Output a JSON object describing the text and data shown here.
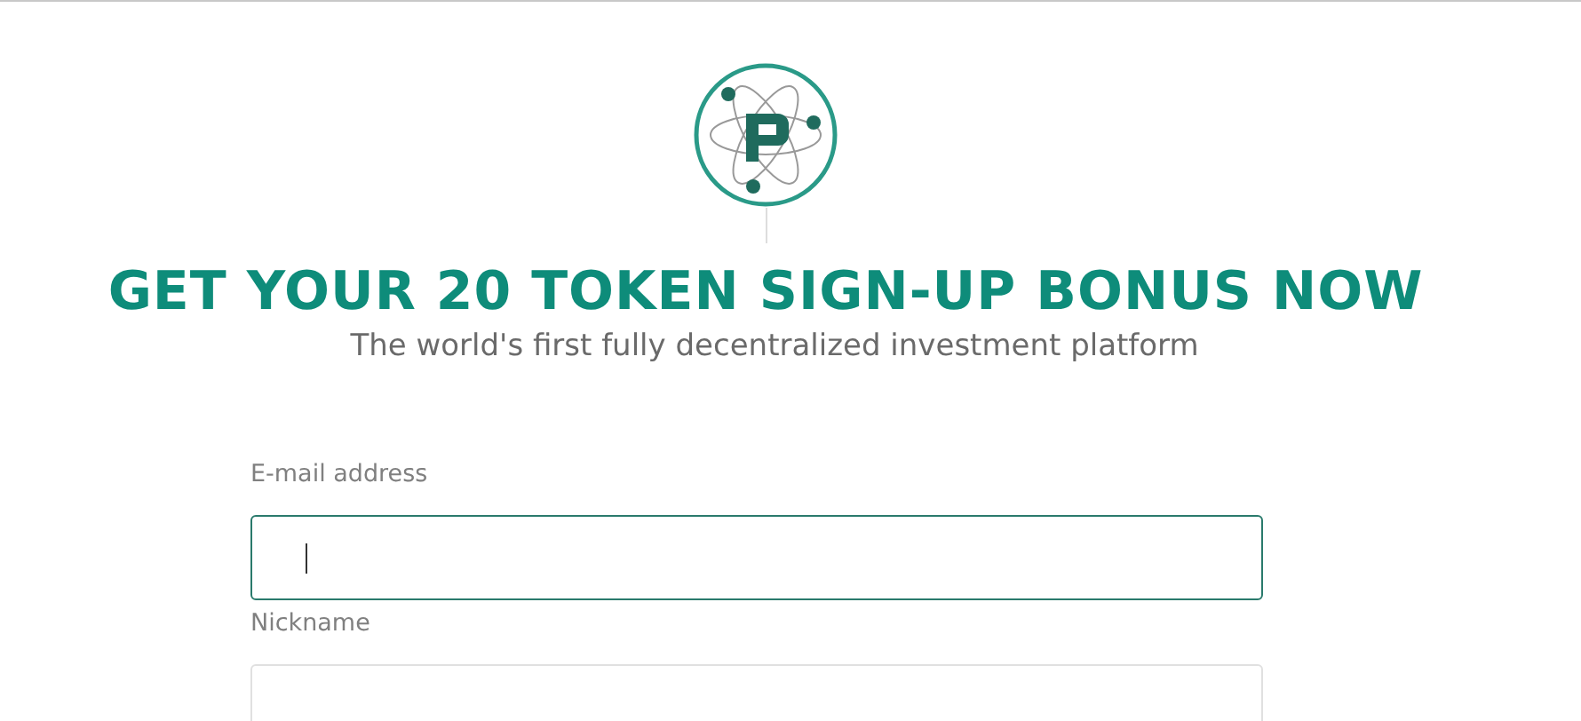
{
  "heading": "GET YOUR 20 TOKEN SIGN-UP BONUS NOW",
  "subtitle": "The world's first fully decentralized investment platform",
  "fields": [
    {
      "label": "E-mail address",
      "focused": true
    },
    {
      "label": "Nickname",
      "focused": false
    }
  ]
}
